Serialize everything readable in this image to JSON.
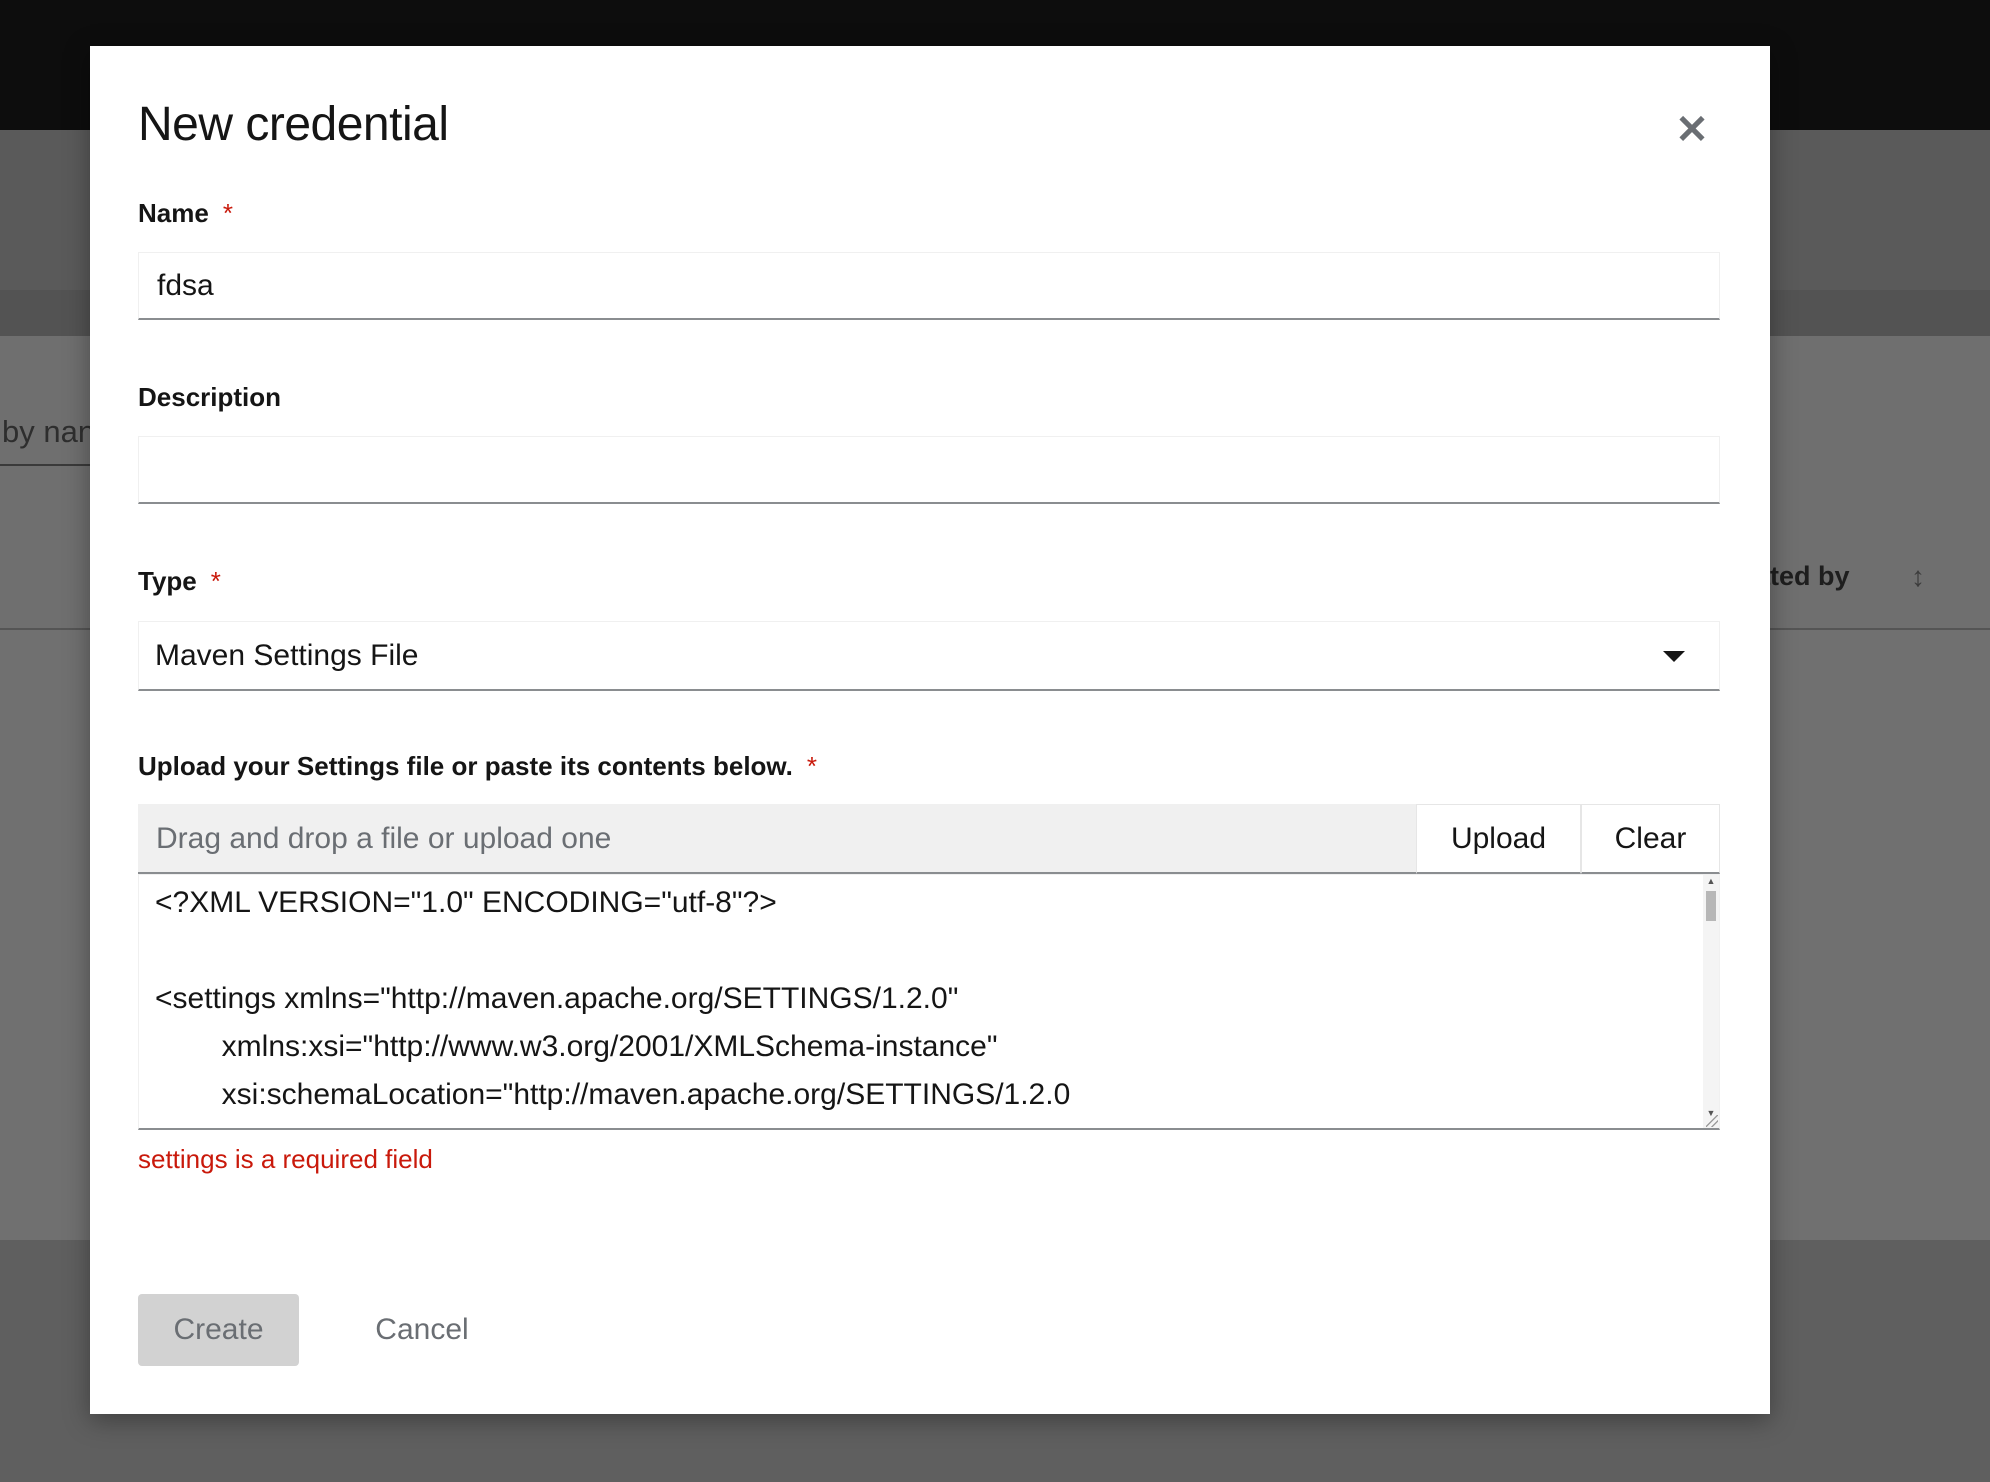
{
  "background": {
    "filter_fragment": "by nan",
    "column_header_fragment": "eated by",
    "sort_icon": "sort-icon"
  },
  "modal": {
    "title": "New credential",
    "close_icon": "close-icon",
    "name": {
      "label": "Name",
      "required_mark": "*",
      "value": "fdsa"
    },
    "description": {
      "label": "Description",
      "value": ""
    },
    "type": {
      "label": "Type",
      "required_mark": "*",
      "selected": "Maven Settings File",
      "caret_icon": "caret-down-icon"
    },
    "settings": {
      "label": "Upload your Settings file or paste its contents below.",
      "required_mark": "*",
      "drop_placeholder": "Drag and drop a file or upload one",
      "upload_label": "Upload",
      "clear_label": "Clear",
      "content_lines": [
        "<?XML VERSION=\"1.0\" ENCODING=\"utf-8\"?>",
        "",
        "<settings xmlns=\"http://maven.apache.org/SETTINGS/1.2.0\"",
        "        xmlns:xsi=\"http://www.w3.org/2001/XMLSchema-instance\"",
        "        xsi:schemaLocation=\"http://maven.apache.org/SETTINGS/1.2.0"
      ],
      "error": "settings is a required field"
    },
    "actions": {
      "create_label": "Create",
      "cancel_label": "Cancel"
    }
  }
}
